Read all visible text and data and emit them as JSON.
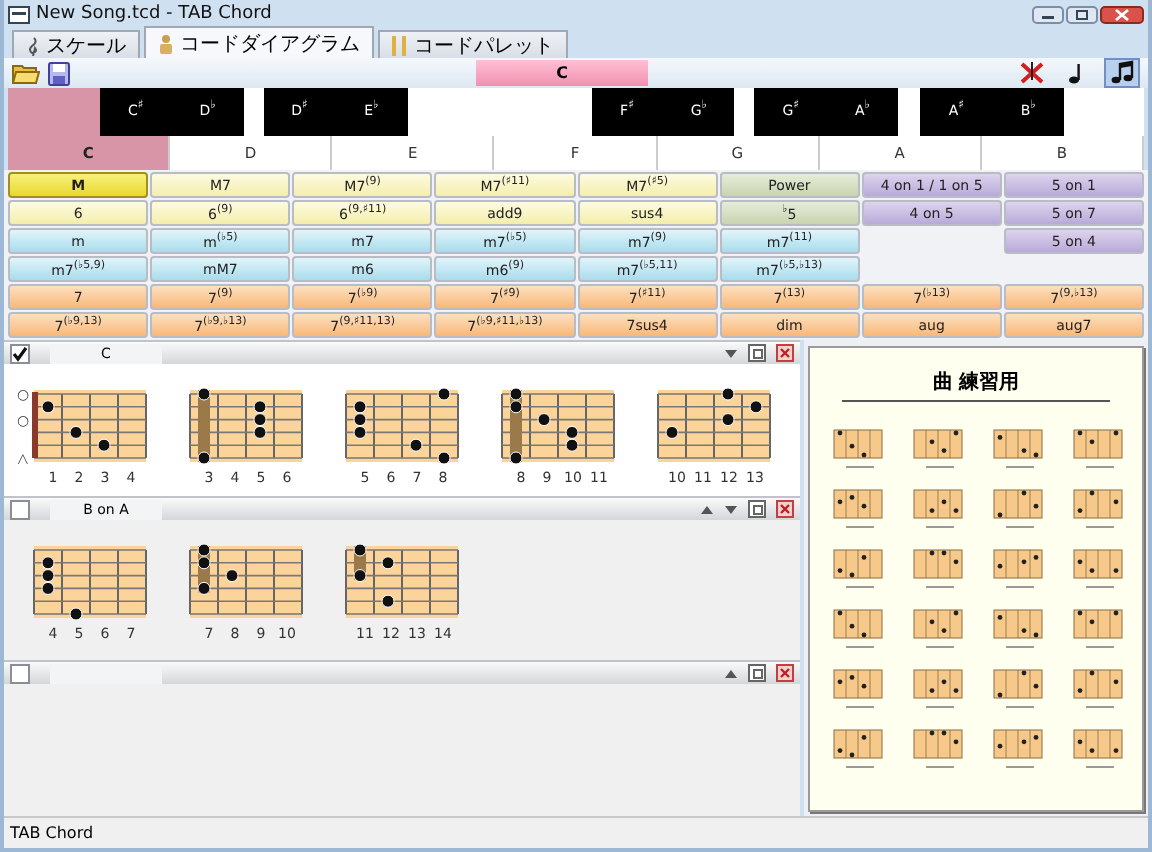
{
  "window": {
    "title": "New Song.tcd - TAB Chord"
  },
  "tabs": [
    {
      "label": "スケール",
      "kind": "scale",
      "selected": false
    },
    {
      "label": "コードダイアグラム",
      "kind": "diagram",
      "selected": true
    },
    {
      "label": "コードパレット",
      "kind": "palette",
      "selected": false
    }
  ],
  "toolbar": {
    "chord_name": "C",
    "tools": [
      {
        "kind": "mute",
        "selected": false
      },
      {
        "kind": "note",
        "selected": false
      },
      {
        "kind": "notes",
        "selected": true
      }
    ]
  },
  "keyboard": {
    "white_keys": [
      {
        "label": "C",
        "selected": true
      },
      {
        "label": "D",
        "selected": false
      },
      {
        "label": "E",
        "selected": false
      },
      {
        "label": "F",
        "selected": false
      },
      {
        "label": "G",
        "selected": false
      },
      {
        "label": "A",
        "selected": false
      },
      {
        "label": "B",
        "selected": false
      }
    ],
    "black_keys": [
      {
        "label": "C$^{♯}$"
      },
      {
        "label": "D$^{♭}$"
      },
      {
        "label": "D$^{♯}$"
      },
      {
        "label": "E$^{♭}$"
      },
      {
        "label": "F$^{♯}$"
      },
      {
        "label": "G$^{♭}$"
      },
      {
        "label": "G$^{♯}$"
      },
      {
        "label": "A$^{♭}$"
      },
      {
        "label": "A$^{♯}$"
      },
      {
        "label": "B$^{♭}$"
      }
    ]
  },
  "chord_types": [
    [
      {
        "label": "M",
        "kind": "major",
        "selected": true
      },
      {
        "label": "M7",
        "kind": "major",
        "selected": false
      },
      {
        "label": "M7$^{(9)}$",
        "kind": "major",
        "selected": false
      },
      {
        "label": "M7$^{(♯11)}$",
        "kind": "major",
        "selected": false
      },
      {
        "label": "M7$^{(♯5)}$",
        "kind": "major",
        "selected": false
      },
      {
        "label": "Power",
        "kind": "power",
        "selected": false
      },
      {
        "label": "4 on 1 / 1 on 5",
        "kind": "slash",
        "selected": false
      },
      {
        "label": "5 on 1",
        "kind": "slash",
        "selected": false
      }
    ],
    [
      {
        "label": "6",
        "kind": "major",
        "selected": false
      },
      {
        "label": "6$^{(9)}$",
        "kind": "major",
        "selected": false
      },
      {
        "label": "6$^{(9,♯11)}$",
        "kind": "major",
        "selected": false
      },
      {
        "label": "add9",
        "kind": "major",
        "selected": false
      },
      {
        "label": "sus4",
        "kind": "major",
        "selected": false
      },
      {
        "label": "$^{♭}$5",
        "kind": "power",
        "selected": false
      },
      {
        "label": "4 on 5",
        "kind": "slash",
        "selected": false
      },
      {
        "label": "5 on 7",
        "kind": "slash",
        "selected": false
      }
    ],
    [
      {
        "label": "m",
        "kind": "minor",
        "selected": false
      },
      {
        "label": "m$^{(♭5)}$",
        "kind": "minor",
        "selected": false
      },
      {
        "label": "m7",
        "kind": "minor",
        "selected": false
      },
      {
        "label": "m7$^{(♭5)}$",
        "kind": "minor",
        "selected": false
      },
      {
        "label": "m7$^{(9)}$",
        "kind": "minor",
        "selected": false
      },
      {
        "label": "m7$^{(11)}$",
        "kind": "minor",
        "selected": false
      },
      {
        "kind": "empty"
      },
      {
        "label": "5 on 4",
        "kind": "slash",
        "selected": false
      }
    ],
    [
      {
        "label": "m7$^{(♭5,9)}$",
        "kind": "minor",
        "selected": false
      },
      {
        "label": "mM7",
        "kind": "minor",
        "selected": false
      },
      {
        "label": "m6",
        "kind": "minor",
        "selected": false
      },
      {
        "label": "m6$^{(9)}$",
        "kind": "minor",
        "selected": false
      },
      {
        "label": "m7$^{(♭5,11)}$",
        "kind": "minor",
        "selected": false
      },
      {
        "label": "m7$^{(♭5,♭13)}$",
        "kind": "minor",
        "selected": false
      },
      {
        "kind": "empty"
      },
      {
        "kind": "empty"
      }
    ],
    [
      {
        "label": "7",
        "kind": "seventh",
        "selected": false
      },
      {
        "label": "7$^{(9)}$",
        "kind": "seventh",
        "selected": false
      },
      {
        "label": "7$^{(♭9)}$",
        "kind": "seventh",
        "selected": false
      },
      {
        "label": "7$^{(♯9)}$",
        "kind": "seventh",
        "selected": false
      },
      {
        "label": "7$^{(♯11)}$",
        "kind": "seventh",
        "selected": false
      },
      {
        "label": "7$^{(13)}$",
        "kind": "seventh",
        "selected": false
      },
      {
        "label": "7$^{(♭13)}$",
        "kind": "seventh",
        "selected": false
      },
      {
        "label": "7$^{(9,♭13)}$",
        "kind": "seventh",
        "selected": false
      }
    ],
    [
      {
        "label": "7$^{(♭9,13)}$",
        "kind": "seventh",
        "selected": false
      },
      {
        "label": "7$^{(♭9,♭13)}$",
        "kind": "seventh",
        "selected": false
      },
      {
        "label": "7$^{(9,♯11,13)}$",
        "kind": "seventh",
        "selected": false
      },
      {
        "label": "7$^{(♭9,♯11,♭13)}$",
        "kind": "seventh",
        "selected": false
      },
      {
        "label": "7sus4",
        "kind": "seventh",
        "selected": false
      },
      {
        "label": "dim",
        "kind": "seventh",
        "selected": false
      },
      {
        "label": "aug",
        "kind": "seventh",
        "selected": false
      },
      {
        "label": "aug7",
        "kind": "seventh",
        "selected": false
      }
    ]
  ],
  "sections": [
    {
      "checked": true,
      "title": "C",
      "up_arrow": false,
      "down_arrow": true,
      "diagrams": [
        {
          "frets": [
            "1",
            "2",
            "3",
            "4"
          ],
          "nut": true,
          "open_marks": [
            "○",
            "○",
            "△"
          ]
        },
        {
          "frets": [
            "3",
            "4",
            "5",
            "6"
          ]
        },
        {
          "frets": [
            "5",
            "6",
            "7",
            "8"
          ]
        },
        {
          "frets": [
            "8",
            "9",
            "10",
            "11"
          ]
        },
        {
          "frets": [
            "10",
            "11",
            "12",
            "13"
          ]
        }
      ]
    },
    {
      "checked": false,
      "title": "B on A",
      "up_arrow": true,
      "down_arrow": true,
      "diagrams": [
        {
          "frets": [
            "4",
            "5",
            "6",
            "7"
          ]
        },
        {
          "frets": [
            "7",
            "8",
            "9",
            "10"
          ]
        },
        {
          "frets": [
            "11",
            "12",
            "13",
            "14"
          ]
        }
      ]
    },
    {
      "checked": false,
      "up_arrow": true,
      "down_arrow": false
    }
  ],
  "sheet": {
    "title": "曲 練習用"
  },
  "status_bar": "TAB Chord"
}
